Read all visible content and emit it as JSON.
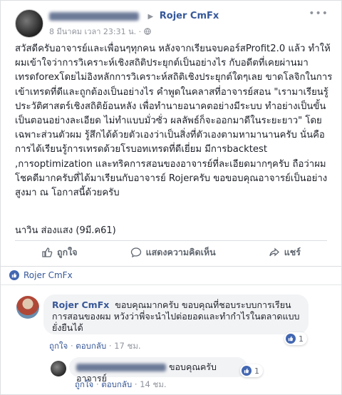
{
  "post": {
    "author_blurred": "Nawin Songsaeng",
    "shared_to": "Rojer CmFx",
    "date": "8 มีนาคม เวลา 23:31 น.",
    "audience_icon": "globe-icon",
    "body": "สวัสดีครับอาจารย์และเพื่อนๆทุกคน หลังจากเรียนจบคอร์สProfit2.0 แล้ว ทำให้ผมเข้าใจว่าการวิเคราะห์เชิงสถิติประยุกต์เป็นอย่างไร กับอดีตที่เคยผ่านมาเทรดforexโดยไม่อิงหลักการวิเคราะห์สถิติเชิงประยุกต์ใดๆเลย ขาดโลจิกในการเข้าเทรดที่ดีและถูกต้องเป็นอย่างไร คำพูดในคลาสที่อาจารย์สอน \"เรามาเรียนรู้ประวัติศาสตร์เชิงสถิติย้อนหลัง เพื่อทำนายอนาคตอย่างมีระบบ ทำอย่างเป็นขั้นเป็นตอนอย่างละเอียด ไม่ทำแบบมั่วซั่ว ผลลัพธ์ก็จะออกมาดีในระยะยาว\" โดยเฉพาะส่วนตัวผม รู้สึกได้ด้วยตัวเองว่าเป็นสิ่งที่ตัวเองตามหามานานครับ นั่นคือการได้เรียนรู้การเทรดด้วยโรบอทเทรดที่ดีเยี่ยม มีการbacktest ,การoptimization และทริคการสอนของอาจารย์ที่ละเอียดมากๆครับ ถือว่าผมโชคดีมากครับที่ได้มาเรียนกับอาจารย์ Rojerครับ ขอขอบคุณอาจารย์เป็นอย่างสูงมา ณ โอกาสนี้ด้วยครับ",
    "signature": "นาวิน ส่องแสง (9มี.ค61)"
  },
  "actions": {
    "like": "ถูกใจ",
    "comment": "แสดงความคิดเห็น",
    "share": "แชร์"
  },
  "shared_page": "Rojer CmFx",
  "comments": [
    {
      "name": "Rojer CmFx",
      "text": "ขอบคุณมากครับ ขอบคุณที่ชอบระบบการเรียนการสอนของผม หวังว่าพี่จะนำไปต่อยอดและทำกำไรในตลาดแบบยั่งยืนได้",
      "reactions": "1",
      "like": "ถูกใจ",
      "reply": "ตอบกลับ",
      "time": "17 ชม."
    },
    {
      "name_blurred": "Nawin Songsaeng",
      "text": "ขอบคุณครับอาจารย์",
      "reactions": "1",
      "like": "ถูกใจ",
      "reply": "ตอบกลับ",
      "time": "14 ชม."
    }
  ],
  "colors": {
    "link": "#365899",
    "muted": "#90949c",
    "fb_blue": "#4267b2"
  }
}
